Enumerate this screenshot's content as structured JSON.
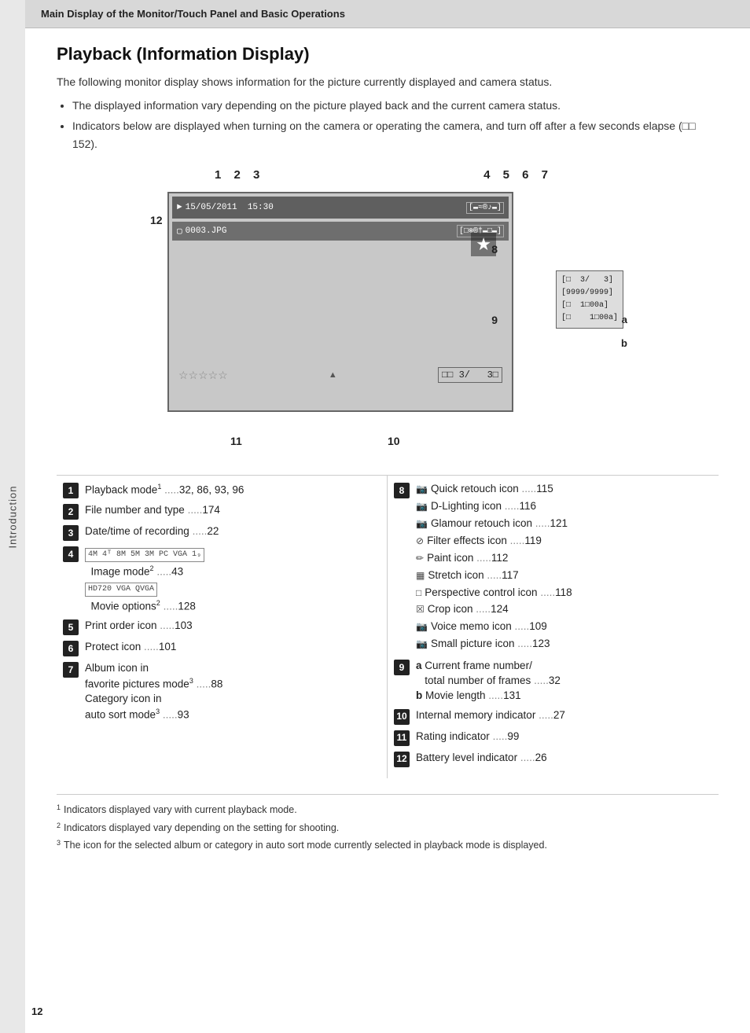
{
  "header": {
    "title": "Main Display of the Monitor/Touch Panel and Basic Operations"
  },
  "sidebar": {
    "label": "Introduction"
  },
  "page": {
    "title": "Playback (Information Display)",
    "intro": "The following monitor display shows information for the picture currently displayed and camera status.",
    "bullets": [
      "The displayed information vary depending on the picture played back and the current camera status.",
      "Indicators below are displayed when turning on the camera or operating the camera, and turn off after a few seconds elapse (□□ 152)."
    ]
  },
  "diagram": {
    "top_labels_left": "1 2  3",
    "top_labels_right": "4 5 6 7",
    "screen": {
      "line1": "►  15/05/2011  15:30",
      "line1_icons": "[■≈®♪■]",
      "line2": "□  0003.JPG",
      "line2_icons": "[■⊗®†■□■]",
      "star": "★",
      "rating": "☆☆☆☆☆",
      "frame_indicator": "■■  3/   3■",
      "right_panel": "[■  3/   3]\n[9999/9999]\n[■  1■00a]\n[■    1■00a]"
    },
    "labels": {
      "num_12": "12",
      "num_8": "8",
      "num_9": "9",
      "num_11": "11",
      "num_10": "10",
      "letter_a": "a",
      "letter_b": "b"
    }
  },
  "left_col": {
    "items": [
      {
        "num": "1",
        "label": "Playback mode",
        "sup": "1",
        "pages": "32, 86, 93, 96"
      },
      {
        "num": "2",
        "label": "File number and type",
        "pages": "174"
      },
      {
        "num": "3",
        "label": "Date/time of recording",
        "pages": "22"
      },
      {
        "num": "4",
        "label": "Image mode",
        "sup": "2",
        "image_icons": "4M 4M 8M 5M 3M PC VGA 169",
        "pages": "43",
        "movie_icons": "HD720 VGA QVGA",
        "movie_label": "Movie options",
        "movie_sup": "2",
        "movie_pages": "128"
      },
      {
        "num": "5",
        "label": "Print order icon",
        "pages": "103"
      },
      {
        "num": "6",
        "label": "Protect icon",
        "pages": "101"
      },
      {
        "num": "7",
        "label": "Album icon in favorite pictures mode",
        "sup": "3",
        "pages": "88",
        "label2": "Category icon in auto sort mode",
        "sup2": "3",
        "pages2": "93"
      }
    ]
  },
  "right_col": {
    "num": "8",
    "items": [
      {
        "icon": "📷",
        "label": "Quick retouch icon",
        "pages": "115"
      },
      {
        "icon": "📷",
        "label": "D-Lighting icon",
        "pages": "116"
      },
      {
        "icon": "📷",
        "label": "Glamour retouch icon",
        "pages": "121"
      },
      {
        "icon": "⊙",
        "label": "Filter effects icon",
        "pages": "119"
      },
      {
        "icon": "✏",
        "label": "Paint icon",
        "pages": "112"
      },
      {
        "icon": "▦",
        "label": "Stretch icon",
        "pages": "117"
      },
      {
        "icon": "□",
        "label": "Perspective control icon",
        "pages": "118"
      },
      {
        "icon": "☒",
        "label": "Crop icon",
        "pages": "124"
      },
      {
        "icon": "📷",
        "label": "Voice memo icon",
        "pages": "109"
      },
      {
        "icon": "📷",
        "label": "Small picture icon",
        "pages": "123"
      }
    ],
    "item9": {
      "num": "9",
      "label_a": "a",
      "text_a": "Current frame number/ total number of frames",
      "pages_a": "32",
      "label_b": "b",
      "text_b": "Movie length",
      "pages_b": "131"
    },
    "item10": {
      "num": "10",
      "label": "Internal memory indicator",
      "pages": "27"
    },
    "item11": {
      "num": "11",
      "label": "Rating indicator",
      "pages": "99"
    },
    "item12": {
      "num": "12",
      "label": "Battery level indicator",
      "pages": "26"
    }
  },
  "footnotes": [
    {
      "num": "1",
      "text": "Indicators displayed vary with current playback mode."
    },
    {
      "num": "2",
      "text": "Indicators displayed vary depending on the setting for shooting."
    },
    {
      "num": "3",
      "text": "The icon for the selected album or category in auto sort mode currently selected in playback mode is displayed."
    }
  ],
  "page_number": "12"
}
